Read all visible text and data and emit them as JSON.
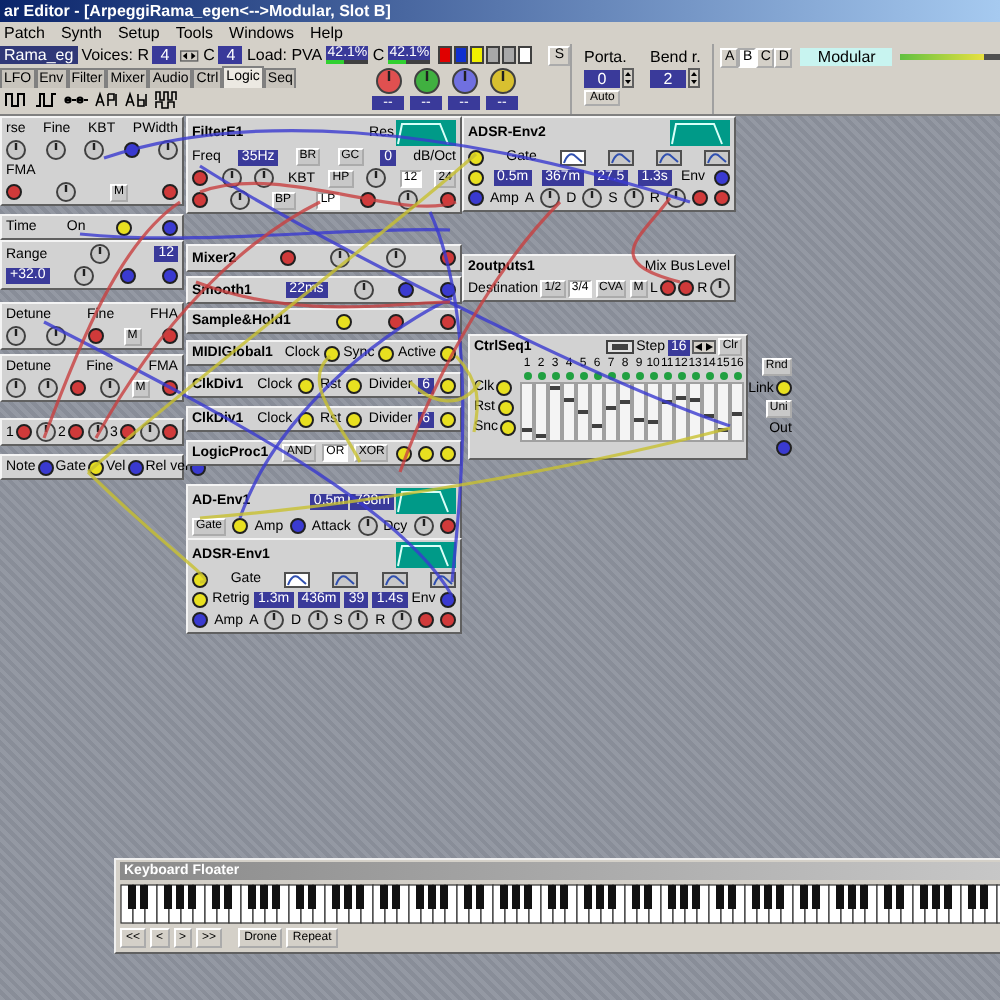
{
  "window": {
    "title": "ar Editor - [ArpeggiRama_egen<-->Modular, Slot B]"
  },
  "menu": [
    "Patch",
    "Synth",
    "Setup",
    "Tools",
    "Windows",
    "Help"
  ],
  "toolbar": {
    "patch_name": "Rama_eg",
    "voices_label": "Voices: R",
    "voices_r": "4",
    "voices_c_label": "C",
    "voices_c": "4",
    "load": [
      {
        "label": "Load: PVA",
        "reading": "42.1%",
        "level": 0.42
      },
      {
        "label": "C",
        "reading": "42.1%",
        "level": 0.42
      }
    ],
    "swatches": [
      {
        "color": "#e00000"
      },
      {
        "color": "#1030d0"
      },
      {
        "color": "#f0f000"
      },
      {
        "color": "#a8a8a8"
      },
      {
        "color": "#a8a8a8"
      },
      {
        "color": "#ffffff"
      }
    ],
    "s_button": "S",
    "morph_knobs": [
      {
        "color": "#e05050",
        "label": "--"
      },
      {
        "color": "#40b040",
        "label": "--"
      },
      {
        "color": "#7070e0",
        "label": "--"
      },
      {
        "color": "#d8c030",
        "label": "--"
      }
    ],
    "porta": {
      "label": "Porta.",
      "value": "0",
      "button": "Auto"
    },
    "bend": {
      "label": "Bend r.",
      "value": "2"
    },
    "slots": [
      {
        "label": "A",
        "selected": false
      },
      {
        "label": "B",
        "selected": true
      },
      {
        "label": "C",
        "selected": false
      },
      {
        "label": "D",
        "selected": false
      }
    ],
    "mode_display": "Modular",
    "meter": {
      "level": 0.8
    }
  },
  "tabs": [
    {
      "label": "LFO",
      "selected": false
    },
    {
      "label": "Env",
      "selected": false
    },
    {
      "label": "Filter",
      "selected": false
    },
    {
      "label": "Mixer",
      "selected": false
    },
    {
      "label": "Audio",
      "selected": false
    },
    {
      "label": "Ctrl",
      "selected": false
    },
    {
      "label": "Logic",
      "selected": true
    },
    {
      "label": "Seq",
      "selected": false
    }
  ],
  "modules": [
    {
      "kind": "panel",
      "rows": [
        {
          "items": [
            {
              "kind": "text",
              "text": "rse"
            },
            {
              "kind": "text",
              "text": "Fine"
            },
            {
              "kind": "text",
              "text": "KBT"
            },
            {
              "kind": "text",
              "text": "PWidth"
            }
          ]
        },
        {
          "items": [
            {
              "kind": "knob"
            },
            {
              "kind": "knob"
            },
            {
              "kind": "knob"
            },
            {
              "kind": "port",
              "color": "#3a3ad0"
            },
            {
              "kind": "knob"
            }
          ]
        },
        {
          "items": [
            {
              "kind": "text",
              "text": "FMA"
            }
          ]
        },
        {
          "items": [
            {
              "kind": "port",
              "color": "#d03a3a"
            },
            {
              "kind": "knob"
            },
            {
              "kind": "button",
              "text": "M"
            },
            {
              "kind": "port",
              "color": "#d03a3a"
            }
          ]
        }
      ]
    },
    {
      "kind": "panel",
      "rows": [
        {
          "items": [
            {
              "kind": "text",
              "text": "Time"
            },
            {
              "kind": "text",
              "text": "On"
            },
            {
              "kind": "port",
              "color": "#e8e020"
            },
            {
              "kind": "port",
              "color": "#3a3ad0"
            }
          ]
        }
      ]
    },
    {
      "kind": "panel",
      "rows": [
        {
          "items": [
            {
              "kind": "text",
              "text": "Range"
            },
            {
              "kind": "knob"
            },
            {
              "kind": "display",
              "text": "12"
            }
          ]
        },
        {
          "items": [
            {
              "kind": "display",
              "text": "+32.0"
            },
            {
              "kind": "knob"
            },
            {
              "kind": "port",
              "color": "#3a3ad0"
            },
            {
              "kind": "port",
              "color": "#3a3ad0"
            }
          ]
        }
      ]
    },
    {
      "kind": "panel",
      "rows": [
        {
          "items": [
            {
              "kind": "text",
              "text": "Detune"
            },
            {
              "kind": "text",
              "text": "Fine"
            },
            {
              "kind": "text",
              "text": "FHA"
            }
          ]
        },
        {
          "items": [
            {
              "kind": "knob"
            },
            {
              "kind": "knob"
            },
            {
              "kind": "port",
              "color": "#d03a3a"
            },
            {
              "kind": "button",
              "text": "M"
            },
            {
              "kind": "port",
              "color": "#d03a3a"
            }
          ]
        }
      ]
    },
    {
      "kind": "panel",
      "rows": [
        {
          "items": [
            {
              "kind": "text",
              "text": "Detune"
            },
            {
              "kind": "text",
              "text": "Fine"
            },
            {
              "kind": "text",
              "text": "FMA"
            }
          ]
        },
        {
          "items": [
            {
              "kind": "knob"
            },
            {
              "kind": "knob"
            },
            {
              "kind": "port",
              "color": "#d03a3a"
            },
            {
              "kind": "knob"
            },
            {
              "kind": "button",
              "text": "M"
            },
            {
              "kind": "port",
              "color": "#d03a3a"
            }
          ]
        }
      ]
    },
    {
      "kind": "panel",
      "rows": [
        {
          "items": [
            {
              "kind": "text",
              "text": "1"
            },
            {
              "kind": "port",
              "color": "#d03a3a"
            },
            {
              "kind": "knob"
            },
            {
              "kind": "text",
              "text": "2"
            },
            {
              "kind": "port",
              "color": "#d03a3a"
            },
            {
              "kind": "knob"
            },
            {
              "kind": "text",
              "text": "3"
            },
            {
              "kind": "port",
              "color": "#d03a3a"
            },
            {
              "kind": "knob"
            },
            {
              "kind": "port",
              "color": "#d03a3a"
            }
          ]
        }
      ]
    },
    {
      "kind": "panel",
      "rows": [
        {
          "items": [
            {
              "kind": "text",
              "text": "Note"
            },
            {
              "kind": "port",
              "color": "#3a3ad0"
            },
            {
              "kind": "text",
              "text": "Gate"
            },
            {
              "kind": "port",
              "color": "#e8e020"
            },
            {
              "kind": "text",
              "text": "Vel"
            },
            {
              "kind": "port",
              "color": "#3a3ad0"
            },
            {
              "kind": "text",
              "text": "Rel vel"
            },
            {
              "kind": "port",
              "color": "#3a3ad0"
            }
          ]
        }
      ]
    },
    {
      "kind": "panel",
      "title": "FilterE1",
      "rows": [
        {
          "items": [
            {
              "kind": "text",
              "text": "Res"
            },
            {
              "kind": "graph"
            }
          ]
        },
        {
          "items": [
            {
              "kind": "text",
              "text": "Freq"
            },
            {
              "kind": "display",
              "text": "35Hz"
            },
            {
              "kind": "button",
              "text": "BR",
              "selected": false
            },
            {
              "kind": "button",
              "text": "GC"
            },
            {
              "kind": "display",
              "text": "0"
            },
            {
              "kind": "text",
              "text": "dB/Oct"
            }
          ]
        },
        {
          "items": [
            {
              "kind": "port",
              "color": "#d03a3a"
            },
            {
              "kind": "knob"
            },
            {
              "kind": "knob"
            },
            {
              "kind": "text",
              "text": "KBT"
            },
            {
              "kind": "button",
              "text": "HP",
              "selected": false
            },
            {
              "kind": "knob"
            },
            {
              "kind": "button",
              "text": "12",
              "selected": true
            },
            {
              "kind": "button",
              "text": "24",
              "selected": false
            }
          ]
        },
        {
          "items": [
            {
              "kind": "port",
              "color": "#d03a3a"
            },
            {
              "kind": "knob"
            },
            {
              "kind": "button",
              "text": "BP",
              "selected": false
            },
            {
              "kind": "button",
              "text": "LP",
              "selected": true
            },
            {
              "kind": "port",
              "color": "#d03a3a"
            },
            {
              "kind": "knob"
            },
            {
              "kind": "port",
              "color": "#d03a3a"
            }
          ]
        }
      ]
    },
    {
      "kind": "panel",
      "title": "ADSR-Env2",
      "rows": [
        {
          "items": [
            {
              "kind": "graph"
            }
          ]
        },
        {
          "items": [
            {
              "kind": "port",
              "color": "#e8e020"
            },
            {
              "kind": "text",
              "text": "Gate"
            },
            {
              "kind": "shape",
              "selected": true
            },
            {
              "kind": "shape",
              "selected": false
            },
            {
              "kind": "shape",
              "selected": false
            },
            {
              "kind": "shape",
              "selected": false
            }
          ]
        },
        {
          "items": [
            {
              "kind": "port",
              "color": "#e8e020"
            },
            {
              "kind": "display",
              "text": "0.5m"
            },
            {
              "kind": "display",
              "text": "367m"
            },
            {
              "kind": "display",
              "text": "27.5"
            },
            {
              "kind": "display",
              "text": "1.3s"
            },
            {
              "kind": "text",
              "text": "Env"
            },
            {
              "kind": "port",
              "color": "#3a3ad0"
            }
          ]
        },
        {
          "items": [
            {
              "kind": "port",
              "color": "#3a3ad0"
            },
            {
              "kind": "text",
              "text": "Amp"
            },
            {
              "kind": "text",
              "text": "A"
            },
            {
              "kind": "knob"
            },
            {
              "kind": "text",
              "text": "D"
            },
            {
              "kind": "knob"
            },
            {
              "kind": "text",
              "text": "S"
            },
            {
              "kind": "knob"
            },
            {
              "kind": "text",
              "text": "R"
            },
            {
              "kind": "knob"
            },
            {
              "kind": "port",
              "color": "#d03a3a"
            },
            {
              "kind": "port",
              "color": "#d03a3a"
            }
          ]
        }
      ]
    },
    {
      "kind": "compact",
      "title": "Mixer2",
      "rows": [
        {
          "items": [
            {
              "kind": "port",
              "color": "#d03a3a"
            },
            {
              "kind": "knob"
            },
            {
              "kind": "knob"
            },
            {
              "kind": "port",
              "color": "#d03a3a"
            }
          ]
        }
      ]
    },
    {
      "kind": "compact",
      "title": "Smooth1",
      "rows": [
        {
          "items": [
            {
              "kind": "display",
              "text": "22ms"
            },
            {
              "kind": "knob"
            },
            {
              "kind": "port",
              "color": "#3a3ad0"
            },
            {
              "kind": "port",
              "color": "#3a3ad0"
            }
          ]
        }
      ]
    },
    {
      "kind": "compact",
      "title": "Sample&Hold1",
      "rows": [
        {
          "items": [
            {
              "kind": "port",
              "color": "#e8e020"
            },
            {
              "kind": "port",
              "color": "#d03a3a"
            },
            {
              "kind": "port",
              "color": "#d03a3a"
            }
          ]
        }
      ]
    },
    {
      "kind": "compact",
      "title": "MIDIGlobal1",
      "rows": [
        {
          "items": [
            {
              "kind": "text",
              "text": "Clock"
            },
            {
              "kind": "port",
              "color": "#e8e020"
            },
            {
              "kind": "text",
              "text": "Sync"
            },
            {
              "kind": "port",
              "color": "#e8e020"
            },
            {
              "kind": "text",
              "text": "Active"
            },
            {
              "kind": "port",
              "color": "#e8e020"
            }
          ]
        }
      ]
    },
    {
      "kind": "compact",
      "title": "ClkDiv1",
      "rows": [
        {
          "items": [
            {
              "kind": "text",
              "text": "Clock"
            },
            {
              "kind": "port",
              "color": "#e8e020"
            },
            {
              "kind": "text",
              "text": "Rst"
            },
            {
              "kind": "port",
              "color": "#e8e020"
            },
            {
              "kind": "text",
              "text": "Divider"
            },
            {
              "kind": "display",
              "text": "6"
            },
            {
              "kind": "port",
              "color": "#e8e020"
            }
          ]
        }
      ]
    },
    {
      "kind": "compact",
      "title": "ClkDiv1",
      "rows": [
        {
          "items": [
            {
              "kind": "text",
              "text": "Clock"
            },
            {
              "kind": "port",
              "color": "#e8e020"
            },
            {
              "kind": "text",
              "text": "Rst"
            },
            {
              "kind": "port",
              "color": "#e8e020"
            },
            {
              "kind": "text",
              "text": "Divider"
            },
            {
              "kind": "display",
              "text": "6"
            },
            {
              "kind": "port",
              "color": "#e8e020"
            }
          ]
        }
      ]
    },
    {
      "kind": "compact",
      "title": "LogicProc1",
      "rows": [
        {
          "items": [
            {
              "kind": "button",
              "text": "AND",
              "selected": false
            },
            {
              "kind": "button",
              "text": "OR",
              "selected": true
            },
            {
              "kind": "button",
              "text": "XOR",
              "selected": false
            },
            {
              "kind": "port",
              "color": "#e8e020"
            },
            {
              "kind": "port",
              "color": "#e8e020"
            },
            {
              "kind": "port",
              "color": "#e8e020"
            }
          ]
        }
      ]
    },
    {
      "kind": "panel",
      "title": "AD-Env1",
      "rows": [
        {
          "items": [
            {
              "kind": "display",
              "text": "0.5m"
            },
            {
              "kind": "display",
              "text": "738m"
            },
            {
              "kind": "graph"
            }
          ]
        },
        {
          "items": [
            {
              "kind": "button",
              "text": "Gate"
            },
            {
              "kind": "port",
              "color": "#e8e020"
            },
            {
              "kind": "text",
              "text": "Amp"
            },
            {
              "kind": "port",
              "color": "#3a3ad0"
            },
            {
              "kind": "text",
              "text": "Attack"
            },
            {
              "kind": "knob"
            },
            {
              "kind": "text",
              "text": "Dcy"
            },
            {
              "kind": "knob"
            },
            {
              "kind": "port",
              "color": "#d03a3a"
            }
          ]
        }
      ]
    },
    {
      "kind": "panel",
      "title": "ADSR-Env1",
      "rows": [
        {
          "items": [
            {
              "kind": "graph"
            }
          ]
        },
        {
          "items": [
            {
              "kind": "port",
              "color": "#e8e020"
            },
            {
              "kind": "text",
              "text": "Gate"
            },
            {
              "kind": "shape",
              "selected": true
            },
            {
              "kind": "shape",
              "selected": false
            },
            {
              "kind": "shape",
              "selected": false
            },
            {
              "kind": "shape",
              "selected": false
            }
          ]
        },
        {
          "items": [
            {
              "kind": "port",
              "color": "#e8e020"
            },
            {
              "kind": "text",
              "text": "Retrig"
            },
            {
              "kind": "display",
              "text": "1.3m"
            },
            {
              "kind": "display",
              "text": "436m"
            },
            {
              "kind": "display",
              "text": "39"
            },
            {
              "kind": "display",
              "text": "1.4s"
            },
            {
              "kind": "text",
              "text": "Env"
            },
            {
              "kind": "port",
              "color": "#3a3ad0"
            }
          ]
        },
        {
          "items": [
            {
              "kind": "port",
              "color": "#3a3ad0"
            },
            {
              "kind": "text",
              "text": "Amp"
            },
            {
              "kind": "text",
              "text": "A"
            },
            {
              "kind": "knob"
            },
            {
              "kind": "text",
              "text": "D"
            },
            {
              "kind": "knob"
            },
            {
              "kind": "text",
              "text": "S"
            },
            {
              "kind": "knob"
            },
            {
              "kind": "text",
              "text": "R"
            },
            {
              "kind": "knob"
            },
            {
              "kind": "port",
              "color": "#d03a3a"
            },
            {
              "kind": "port",
              "color": "#d03a3a"
            }
          ]
        }
      ]
    },
    {
      "kind": "panel",
      "title": "2outputs1",
      "rows": [
        {
          "items": [
            {
              "kind": "text",
              "text": "Mix Bus"
            },
            {
              "kind": "text",
              "text": "Level"
            }
          ]
        },
        {
          "items": [
            {
              "kind": "text",
              "text": "Destination"
            },
            {
              "kind": "button",
              "text": "1/2",
              "selected": false
            },
            {
              "kind": "button",
              "text": "3/4",
              "selected": true
            },
            {
              "kind": "button",
              "text": "CVA",
              "selected": false
            },
            {
              "kind": "button",
              "text": "M"
            },
            {
              "kind": "text",
              "text": "L"
            },
            {
              "kind": "port",
              "color": "#d03a3a"
            },
            {
              "kind": "port",
              "color": "#d03a3a"
            },
            {
              "kind": "text",
              "text": "R"
            },
            {
              "kind": "knob"
            }
          ]
        }
      ]
    },
    {
      "kind": "sequencer",
      "title": "CtrlSeq1",
      "step_label": "Step",
      "step": "16",
      "buttons": [
        "Clr",
        "Rnd",
        "Uni"
      ],
      "inputs": [
        {
          "label": "Clk",
          "color": "#e8e020"
        },
        {
          "label": "Rst",
          "color": "#e8e020"
        },
        {
          "label": "Snc",
          "color": "#e8e020"
        }
      ],
      "outputs": [
        {
          "label": "Link",
          "color": "#e8e020"
        },
        {
          "label": "Out",
          "color": "#3a3ad0"
        }
      ],
      "steps": [
        {
          "number": "1",
          "level": 0.2
        },
        {
          "number": "2",
          "level": 0.1
        },
        {
          "number": "3",
          "level": 0.95
        },
        {
          "number": "4",
          "level": 0.75
        },
        {
          "number": "5",
          "level": 0.55
        },
        {
          "number": "6",
          "level": 0.3
        },
        {
          "number": "7",
          "level": 0.6
        },
        {
          "number": "8",
          "level": 0.7
        },
        {
          "number": "9",
          "level": 0.4
        },
        {
          "number": "10",
          "level": 0.35
        },
        {
          "number": "11",
          "level": 0.7
        },
        {
          "number": "12",
          "level": 0.8
        },
        {
          "number": "13",
          "level": 0.75
        },
        {
          "number": "14",
          "level": 0.45
        },
        {
          "number": "15",
          "level": 0.2
        },
        {
          "number": "16",
          "level": 0.5
        }
      ]
    },
    {
      "kind": "keyboard",
      "title": "Keyboard Floater",
      "nav_buttons": [
        "<<",
        "<",
        ">",
        ">>"
      ],
      "buttons": [
        "Drone",
        "Repeat"
      ]
    }
  ]
}
